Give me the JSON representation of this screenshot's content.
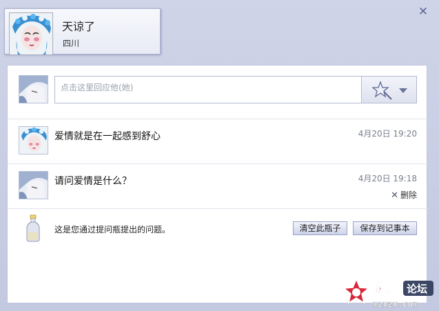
{
  "dialog": {
    "close_icon": "close-icon",
    "profile": {
      "name": "天谅了",
      "location": "四川"
    }
  },
  "reply": {
    "placeholder": "点击这里回应他(她)",
    "emoji_icon": "star-wand-icon"
  },
  "messages": [
    {
      "text": "爱情就是在一起感到舒心",
      "time": "4月20日 19:20"
    },
    {
      "text": "请问爱情是什么？",
      "time": "4月20日 19:18",
      "delete_label": "删除"
    }
  ],
  "footer": {
    "bottle_text": "这是您通过提问瓶提出的问题。",
    "clear_button": "清空此瓶子",
    "save_button": "保存到记事本"
  },
  "watermark": {
    "brand": "纵兔",
    "label": "论坛",
    "domain": "mzxzx.com"
  }
}
